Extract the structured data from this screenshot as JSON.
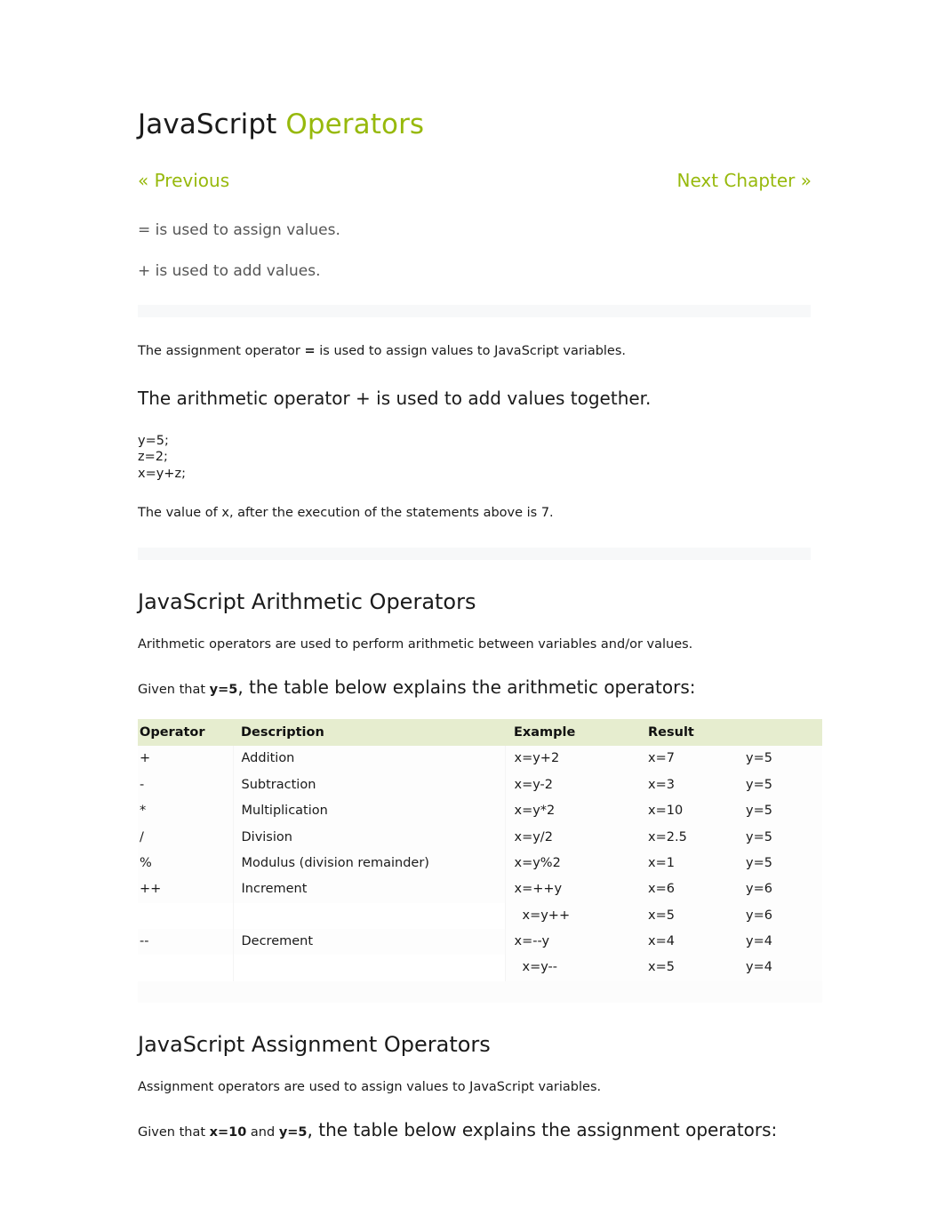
{
  "document": {
    "title_black": "JavaScript ",
    "title_accent": "Operators"
  },
  "nav": {
    "previous": "« Previous",
    "next": "Next Chapter »"
  },
  "intro": {
    "line1": "= is used to assign values.",
    "line2": "+ is used to add values."
  },
  "assignment_intro": {
    "text_before": "The assignment operator ",
    "bold": "=",
    "text_after": " is used to assign values to JavaScript variables."
  },
  "arithmetic_intro": {
    "heading": "The arithmetic operator + is used to add values together.",
    "code": "y=5;\nz=2;\nx=y+z;",
    "note": "The value of x, after the execution of the statements above is 7."
  },
  "arithmetic_section": {
    "heading": "JavaScript Arithmetic Operators",
    "lead": "Arithmetic operators are used to perform arithmetic between variables and/or values.",
    "given_prefix": "Given that ",
    "given_bold": "y=5",
    "given_suffix": ", the table below explains the arithmetic operators:"
  },
  "arithmetic_table": {
    "headers": [
      "Operator",
      "Description",
      "Example",
      "Result",
      ""
    ],
    "rows": [
      {
        "operator": "+",
        "description": "Addition",
        "example": "x=y+2",
        "result": "x=7",
        "result2": "y=5",
        "indent": false,
        "continuation": false
      },
      {
        "operator": "-",
        "description": "Subtraction",
        "example": "x=y-2",
        "result": "x=3",
        "result2": "y=5",
        "indent": false,
        "continuation": false
      },
      {
        "operator": "*",
        "description": "Multiplication",
        "example": "x=y*2",
        "result": "x=10",
        "result2": "y=5",
        "indent": false,
        "continuation": false
      },
      {
        "operator": "/",
        "description": "Division",
        "example": "x=y/2",
        "result": "x=2.5",
        "result2": "y=5",
        "indent": false,
        "continuation": false
      },
      {
        "operator": "%",
        "description": "Modulus (division remainder)",
        "example": "x=y%2",
        "result": "x=1",
        "result2": "y=5",
        "indent": false,
        "continuation": false
      },
      {
        "operator": "++",
        "description": "Increment",
        "example": "x=++y",
        "result": "x=6",
        "result2": "y=6",
        "indent": false,
        "continuation": false
      },
      {
        "operator": "",
        "description": "",
        "example": "x=y++",
        "result": "x=5",
        "result2": "y=6",
        "indent": true,
        "continuation": true
      },
      {
        "operator": "--",
        "description": "Decrement",
        "example": "x=--y",
        "result": "x=4",
        "result2": "y=4",
        "indent": false,
        "continuation": false
      },
      {
        "operator": "",
        "description": "",
        "example": "x=y--",
        "result": "x=5",
        "result2": "y=4",
        "indent": true,
        "continuation": true
      }
    ]
  },
  "assignment_section": {
    "heading": "JavaScript Assignment Operators",
    "lead": "Assignment operators are used to assign values to JavaScript variables.",
    "given_prefix": "Given that ",
    "given_bold1": "x=10",
    "given_mid": " and ",
    "given_bold2": "y=5",
    "given_suffix": ", the table below explains the assignment operators:"
  },
  "colors": {
    "accent_green": "#97b90c",
    "table_header_bg": "#e6edcf",
    "gray_text": "#555555"
  }
}
